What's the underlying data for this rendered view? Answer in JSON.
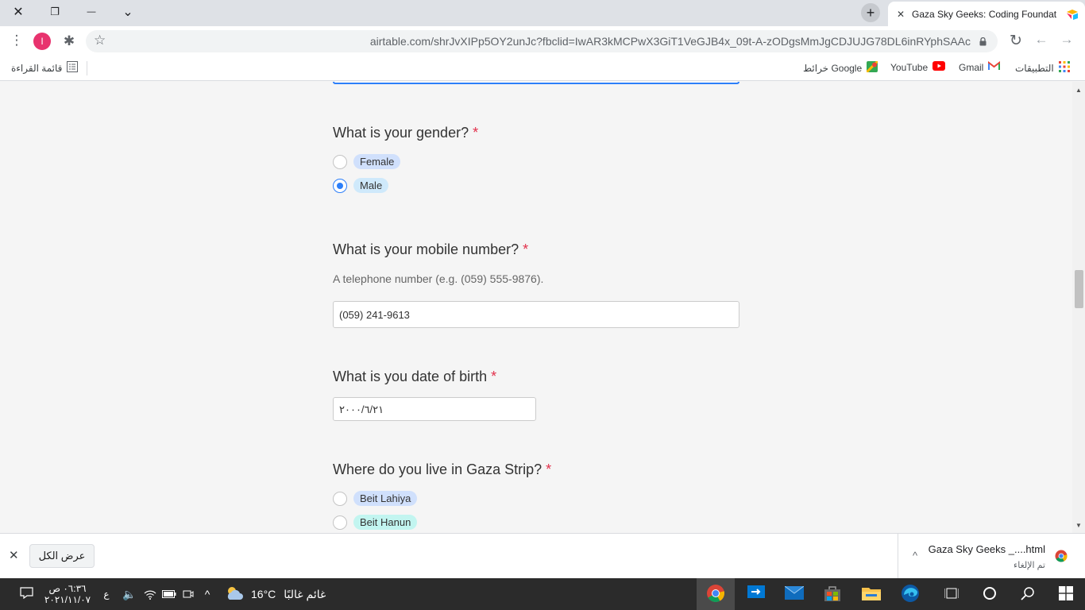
{
  "window": {
    "close": "✕",
    "restore": "❐",
    "minimize": "—",
    "tabs_menu": "⌄"
  },
  "tab": {
    "title": "Gaza Sky Geeks: Coding Foundat",
    "close": "✕",
    "new_tab": "+"
  },
  "toolbar": {
    "url": "airtable.com/shrJvXIPp5OY2unJc?fbclid=IwAR3kMCPwX3GiT1VeGJB4x_09t-A-zODgsMmJgCDJUJG78DL6inRYphSAAc",
    "profile_initial": "I",
    "menu_icon": "⋮",
    "extensions_icon": "✱",
    "star_icon": "☆",
    "reload_icon": "↻",
    "back_icon": "←",
    "forward_icon": "→"
  },
  "bookmarks": {
    "reading_list": "قائمة القراءة",
    "maps": "خرائط Google",
    "youtube": "YouTube",
    "gmail": "Gmail",
    "apps": "التطبيقات"
  },
  "form": {
    "gender": {
      "label": "What is your gender?",
      "required": "*",
      "options": [
        {
          "label": "Female",
          "selected": false,
          "color": "#d0e0fc"
        },
        {
          "label": "Male",
          "selected": true,
          "color": "#cfe9fb"
        }
      ]
    },
    "mobile": {
      "label": "What is your mobile number?",
      "required": "*",
      "helper": "A telephone number (e.g. (059) 555-9876).",
      "value": "(059) 241-9613"
    },
    "dob": {
      "label": "What is you date of birth",
      "required": "*",
      "value": "٢٠٠٠/٦/٢١"
    },
    "location": {
      "label": "Where do you live in Gaza Strip?",
      "required": "*",
      "options": [
        {
          "label": "Beit Lahiya",
          "selected": false,
          "color": "#d0e0fc"
        },
        {
          "label": "Beit Hanun",
          "selected": false,
          "color": "#c2f5f0"
        }
      ]
    }
  },
  "downloads": {
    "file_name": "Gaza Sky Geeks _....html",
    "status": "تم الإلغاء",
    "show_all": "عرض الكل",
    "close": "✕",
    "expand": "^"
  },
  "taskbar": {
    "time": "٠٦:٣٦ ص",
    "date": "٢٠٢١/١١/٠٧",
    "lang": "ع",
    "temperature": "16°C",
    "weather": "غائم غالبًا",
    "tray_expand": "^"
  },
  "colors": {
    "accent": "#2d7ff9",
    "required": "#e2304b"
  }
}
